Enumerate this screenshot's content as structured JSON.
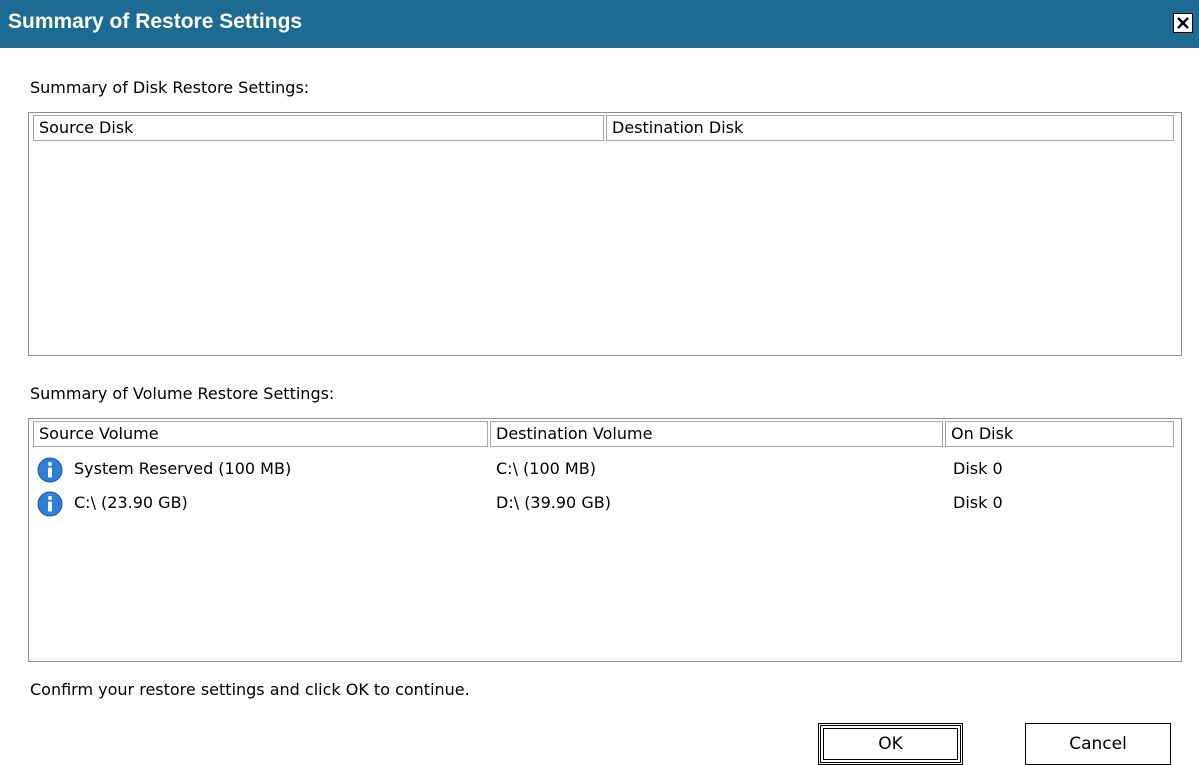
{
  "window": {
    "title": "Summary of Restore Settings"
  },
  "disk_section": {
    "label": "Summary of Disk Restore Settings:",
    "columns": [
      "Source Disk",
      "Destination Disk"
    ]
  },
  "volume_section": {
    "label": "Summary of Volume Restore Settings:",
    "columns": [
      "Source Volume",
      "Destination Volume",
      "On Disk"
    ],
    "rows": [
      {
        "source": "System Reserved (100 MB)",
        "destination": "C:\\ (100 MB)",
        "disk": "Disk 0"
      },
      {
        "source": "C:\\ (23.90 GB)",
        "destination": "D:\\ (39.90 GB)",
        "disk": "Disk 0"
      }
    ]
  },
  "footer": {
    "message": "Confirm your restore settings and click OK to continue.",
    "ok_label": "OK",
    "cancel_label": "Cancel"
  },
  "icons": {
    "close": "close-icon",
    "row": "info-icon"
  },
  "colors": {
    "titlebar": "#1d6a93",
    "info_icon": "#2f7fd6"
  }
}
